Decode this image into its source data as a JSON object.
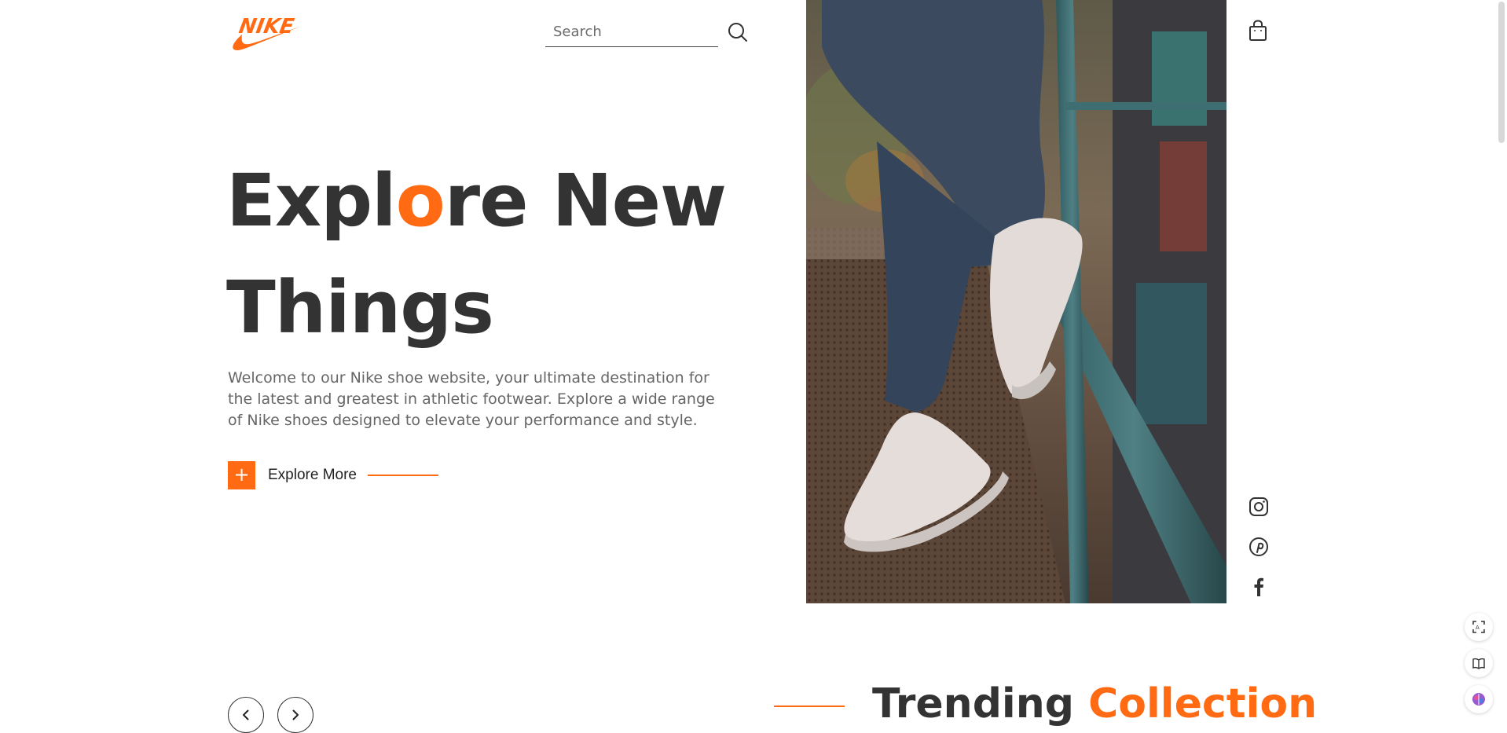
{
  "brand": {
    "logo_text": "NIKE"
  },
  "search": {
    "placeholder": "Search"
  },
  "hero": {
    "title_part1": "Expl",
    "title_accent": "o",
    "title_part2": "re New",
    "title_line2": "Things",
    "description": "Welcome to our Nike shoe website, your ultimate destination for the latest and greatest in athletic footwear. Explore a wide range of Nike shoes designed to elevate your performance and style.",
    "cta_label": "Explore More",
    "cta_icon": "+"
  },
  "trending": {
    "title_plain": "Trending",
    "title_accent": "Collection"
  },
  "icons": {
    "search": "search-icon",
    "cart": "shopping-bag-icon",
    "social": [
      "instagram-icon",
      "pinterest-icon",
      "facebook-icon"
    ],
    "carousel": [
      "chevron-left-icon",
      "chevron-right-icon"
    ],
    "side_tools": [
      "screenshot-translate-icon",
      "book-icon",
      "brain-icon"
    ]
  },
  "colors": {
    "accent": "#ff6a13",
    "text_dark": "#333333",
    "text_muted": "#666666"
  }
}
